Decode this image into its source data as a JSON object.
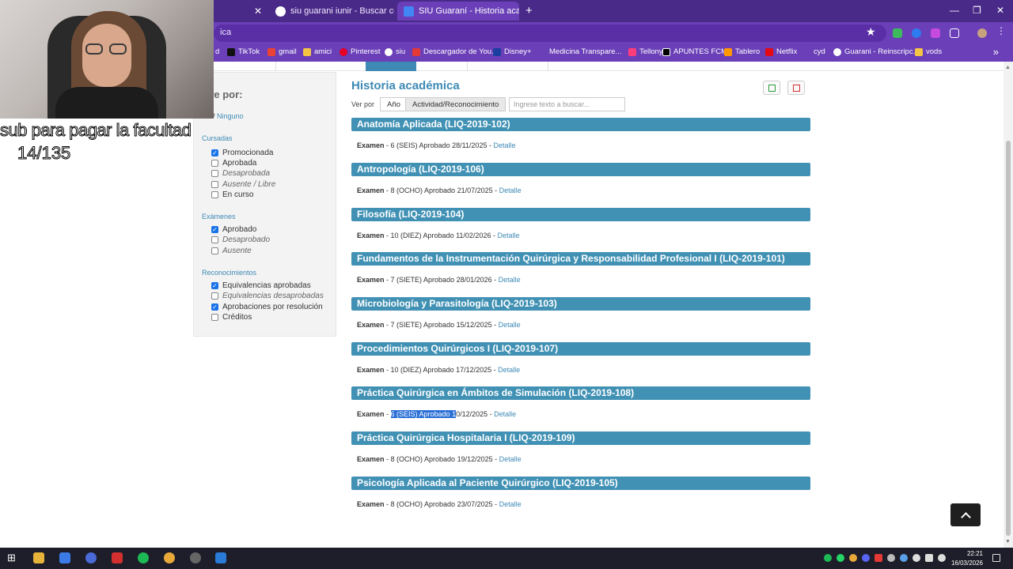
{
  "browser": {
    "tabs": [
      {
        "label": "siu guarani iunir - Buscar con G",
        "active": false
      },
      {
        "label": "SIU Guaraní - Historia académ",
        "active": true
      }
    ],
    "url": "ica",
    "bookmarks": [
      "d",
      "TikTok",
      "gmail",
      "amici",
      "Pinterest",
      "siu",
      "Descargador de You...",
      "Disney+",
      "Medicina Transpare...",
      "Tellonym",
      "APUNTES FCM",
      "Tablero",
      "Netflix",
      "cyd",
      "Guarani - Reinscripc...",
      "vods"
    ]
  },
  "overlay": {
    "caption": "sub para pagar la facultad",
    "count": "14/135"
  },
  "filters": {
    "title": "tre por:",
    "todos_link": "es",
    "todos_sep": " / ",
    "ninguno_link": "Ninguno",
    "cursadas_label": "Cursadas",
    "cursadas": [
      {
        "label": "Promocionada",
        "checked": true
      },
      {
        "label": "Aprobada",
        "checked": false
      },
      {
        "label": "Desaprobada",
        "checked": false
      },
      {
        "label": "Ausente / Libre",
        "checked": false
      },
      {
        "label": "En curso",
        "checked": false
      }
    ],
    "examenes_label": "Exámenes",
    "examenes": [
      {
        "label": "Aprobado",
        "checked": true
      },
      {
        "label": "Desaprobado",
        "checked": false
      },
      {
        "label": "Ausente",
        "checked": false
      }
    ],
    "reconocimientos_label": "Reconocimientos",
    "reconocimientos": [
      {
        "label": "Equivalencias aprobadas",
        "checked": true
      },
      {
        "label": "Equivalencias desaprobadas",
        "checked": false
      },
      {
        "label": "Aprobaciones por resolución",
        "checked": true
      },
      {
        "label": "Créditos",
        "checked": false
      }
    ]
  },
  "main": {
    "title": "Historia académica",
    "ver_por_label": "Ver por",
    "view_options": [
      "Año",
      "Actividad/Reconocimiento"
    ],
    "search_placeholder": "Ingrese texto a buscar...",
    "detail_label": "Detalle",
    "courses": [
      {
        "name": "Anatomía Aplicada (LIQ-2019-102)",
        "type": "Examen",
        "result": "6 (SEIS) Aprobado 28/11/2025"
      },
      {
        "name": "Antropología (LIQ-2019-106)",
        "type": "Examen",
        "result": "8 (OCHO) Aprobado 21/07/2025"
      },
      {
        "name": "Filosofía (LIQ-2019-104)",
        "type": "Examen",
        "result": "10 (DIEZ) Aprobado 11/02/2026"
      },
      {
        "name": "Fundamentos de la Instrumentación Quirúrgica y Responsabilidad Profesional I (LIQ-2019-101)",
        "type": "Examen",
        "result": "7 (SIETE) Aprobado 28/01/2026"
      },
      {
        "name": "Microbiología y Parasitología (LIQ-2019-103)",
        "type": "Examen",
        "result": "7 (SIETE) Aprobado 15/12/2025"
      },
      {
        "name": "Procedimientos Quirúrgicos I (LIQ-2019-107)",
        "type": "Examen",
        "result": "10 (DIEZ) Aprobado 17/12/2025"
      },
      {
        "name": "Práctica Quirúrgica en Ámbitos de Simulación (LIQ-2019-108)",
        "type": "Examen",
        "result_highlight": "6 (SEIS) Aprobado 1",
        "result_rest": "0/12/2025"
      },
      {
        "name": "Práctica Quirúrgica Hospitalaria I (LIQ-2019-109)",
        "type": "Examen",
        "result": "8 (OCHO) Aprobado 19/12/2025"
      },
      {
        "name": "Psicología Aplicada al Paciente Quirúrgico (LIQ-2019-105)",
        "type": "Examen",
        "result": "8 (OCHO) Aprobado 23/07/2025"
      }
    ]
  },
  "taskbar": {
    "time": "22:21",
    "date": "16/03/2026"
  },
  "colors": {
    "accent": "#3e8ab5",
    "course_bar": "#4191b4",
    "browser_frame": "#6a3fb8"
  }
}
